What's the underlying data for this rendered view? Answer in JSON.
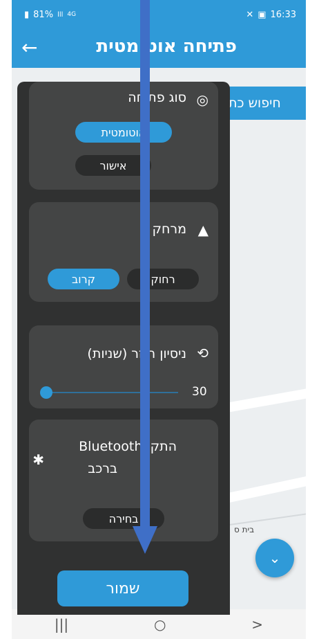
{
  "status_bar": {
    "battery": "81%",
    "signal": "lll",
    "network": "4G",
    "time": "16:33",
    "icons": [
      "battery-icon",
      "signal-icon",
      "gallery-icon",
      "tools-icon"
    ]
  },
  "app_bar": {
    "back_icon": "arrow-left-icon",
    "title": "פתיחה אוטומטית"
  },
  "map": {
    "search_placeholder": "חיפוש כת",
    "place_label": "בית ס",
    "fab_icon": "chevron-down-icon"
  },
  "panel": {
    "open_type": {
      "title": "סוג פתיחה",
      "icon": "open-type-icon",
      "options": [
        {
          "label": "אוטומטית",
          "selected": true
        },
        {
          "label": "אישור",
          "selected": false
        }
      ]
    },
    "distance": {
      "title": "מרחק",
      "icon": "navigation-arrow-icon",
      "options": [
        {
          "label": "רחוק",
          "selected": false
        },
        {
          "label": "קרוב",
          "selected": true
        }
      ]
    },
    "retry": {
      "title": "ניסיון חוזר (שניות)",
      "icon": "history-icon",
      "value": "30",
      "slider_fraction": 0.0
    },
    "bluetooth": {
      "title_line1": "התקן Bluetooth",
      "title_line2": "ברכב",
      "icon": "bluetooth-icon",
      "button": "בחירה"
    },
    "save_label": "שמור"
  },
  "nav_bar": {
    "recent": "|||",
    "home": "○",
    "back": ">"
  },
  "colors": {
    "accent": "#2f9ad8",
    "panel_bg": "#303131",
    "card_bg": "#444545",
    "annotation_arrow": "#3f6fc7"
  }
}
